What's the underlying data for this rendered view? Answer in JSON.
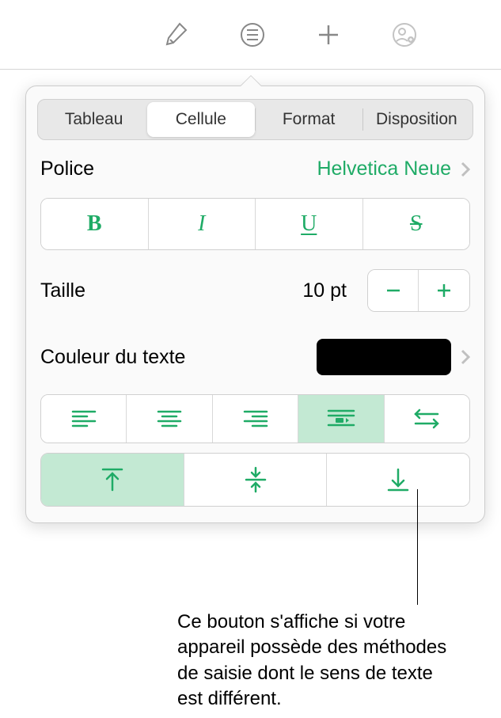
{
  "toolbar": {
    "icons": [
      "brush-icon",
      "list-icon",
      "plus-icon",
      "collaborate-icon"
    ]
  },
  "tabs": {
    "items": [
      "Tableau",
      "Cellule",
      "Format",
      "Disposition"
    ],
    "active_index": 1
  },
  "font": {
    "label": "Police",
    "value": "Helvetica Neue"
  },
  "styles": {
    "bold": "B",
    "italic": "I",
    "underline": "U",
    "strike": "S"
  },
  "size": {
    "label": "Taille",
    "value": "10 pt"
  },
  "text_color": {
    "label": "Couleur du texte",
    "value": "#000000"
  },
  "h_align_active": 3,
  "v_align_active": 0,
  "callout": "Ce bouton s'affiche si votre appareil possède des méthodes de saisie dont le sens de texte est différent."
}
